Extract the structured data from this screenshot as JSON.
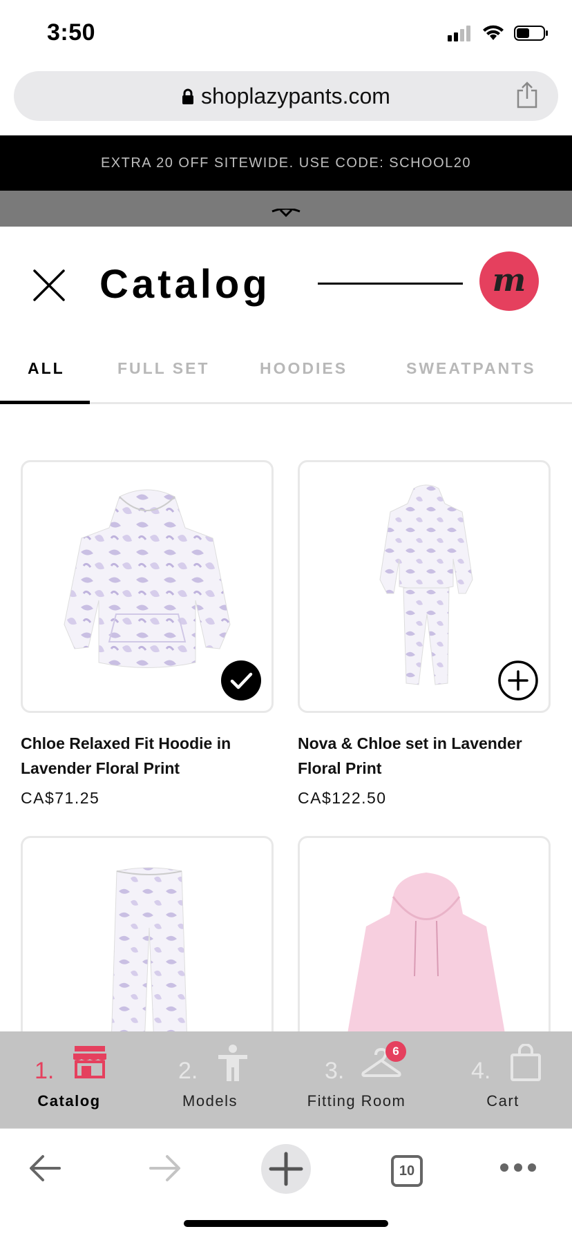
{
  "status_bar": {
    "time": "3:50",
    "icons": [
      "cellular-signal-icon",
      "wifi-icon",
      "battery-icon"
    ]
  },
  "browser": {
    "url": "shoplazypants.com",
    "lock_icon": "lock-icon",
    "share_icon": "share-icon"
  },
  "promo": {
    "text": "EXTRA 20 OFF SITEWIDE. USE CODE: SCHOOL20"
  },
  "header": {
    "title": "Catalog",
    "logo_letter": "m",
    "colors": {
      "brand": "#e5405e"
    }
  },
  "tabs": [
    {
      "label": "ALL",
      "active": true
    },
    {
      "label": "FULL SET",
      "active": false
    },
    {
      "label": "HOODIES",
      "active": false
    },
    {
      "label": "SWEATPANTS",
      "active": false
    }
  ],
  "products": [
    {
      "name": "Chloe Relaxed Fit Hoodie in Lavender Floral Print",
      "price": "CA$71.25",
      "state": "selected",
      "icon": "checkmark-icon"
    },
    {
      "name": "Nova & Chloe set in Lavender Floral Print",
      "price": "CA$122.50",
      "state": "add",
      "icon": "plus-circle-icon"
    },
    {
      "name": "",
      "price": "",
      "state": "",
      "icon": ""
    },
    {
      "name": "",
      "price": "",
      "state": "",
      "icon": ""
    }
  ],
  "wizard": {
    "steps": [
      {
        "number": "1.",
        "label": "Catalog",
        "icon": "store-icon",
        "active": true
      },
      {
        "number": "2.",
        "label": "Models",
        "icon": "person-icon",
        "active": false
      },
      {
        "number": "3.",
        "label": "Fitting Room",
        "icon": "hanger-icon",
        "active": false,
        "badge": "6"
      },
      {
        "number": "4.",
        "label": "Cart",
        "icon": "shopping-bag-icon",
        "active": false
      }
    ]
  },
  "toolbar": {
    "tabs_count": "10",
    "buttons": [
      "back-arrow-icon",
      "forward-arrow-icon",
      "new-tab-plus-icon",
      "tabs-icon",
      "more-icon"
    ]
  }
}
